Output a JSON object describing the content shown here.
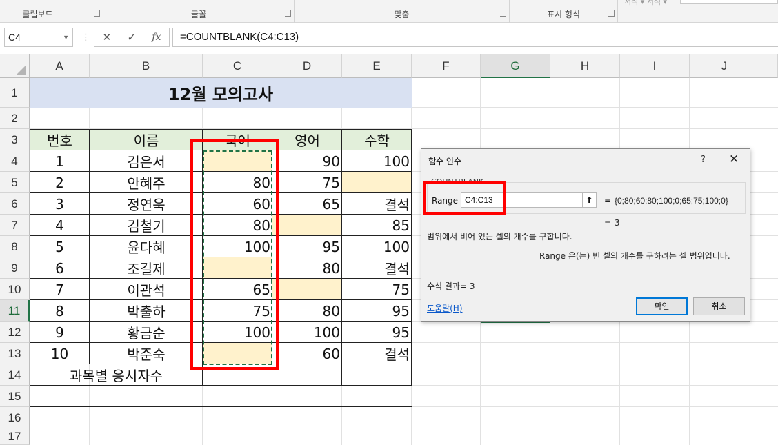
{
  "ribbon": {
    "groups": [
      {
        "label": "클립보드"
      },
      {
        "label": "글꼴"
      },
      {
        "label": "맞춤"
      },
      {
        "label": "표시 형식"
      }
    ],
    "truncated_label": "서식 ▾  서식 ▾"
  },
  "formula_bar": {
    "name_box": "C4",
    "cancel_symbol": "✕",
    "enter_symbol": "✓",
    "fx_symbol": "fx",
    "formula": "=COUNTBLANK(C4:C13)"
  },
  "sheet": {
    "columns": [
      "A",
      "B",
      "C",
      "D",
      "E",
      "F",
      "G",
      "H",
      "I",
      "J"
    ],
    "active_column": "G",
    "rows": [
      "1",
      "2",
      "3",
      "4",
      "5",
      "6",
      "7",
      "8",
      "9",
      "10",
      "11",
      "12",
      "13",
      "14",
      "15",
      "16",
      "17"
    ],
    "active_row": "11",
    "title": "12월 모의고사",
    "headers": [
      "번호",
      "이름",
      "국어",
      "영어",
      "수학"
    ],
    "records": [
      {
        "no": "1",
        "name": "김은서",
        "kor": "",
        "eng": "90",
        "math": "100"
      },
      {
        "no": "2",
        "name": "안혜주",
        "kor": "80",
        "eng": "75",
        "math": ""
      },
      {
        "no": "3",
        "name": "정연욱",
        "kor": "60",
        "eng": "65",
        "math": "결석"
      },
      {
        "no": "4",
        "name": "김철기",
        "kor": "80",
        "eng": "",
        "math": "85"
      },
      {
        "no": "5",
        "name": "윤다혜",
        "kor": "100",
        "eng": "95",
        "math": "100"
      },
      {
        "no": "6",
        "name": "조길제",
        "kor": "",
        "eng": "80",
        "math": "결석"
      },
      {
        "no": "7",
        "name": "이관석",
        "kor": "65",
        "eng": "",
        "math": "75"
      },
      {
        "no": "8",
        "name": "박출하",
        "kor": "75",
        "eng": "80",
        "math": "95"
      },
      {
        "no": "9",
        "name": "황금순",
        "kor": "100",
        "eng": "100",
        "math": "95"
      },
      {
        "no": "10",
        "name": "박준숙",
        "kor": "",
        "eng": "60",
        "math": "결석"
      }
    ],
    "summary_label": "과목별 응시자수",
    "colors": {
      "title_fill": "#d9e1f2",
      "header_fill": "#e2efda",
      "blank_fill": "#fff2cc",
      "highlight": "#ff0000",
      "excel_green": "#217346"
    }
  },
  "dialog": {
    "title": "함수 인수",
    "help_icon": "?",
    "close_icon": "✕",
    "function_name": "COUNTBLANK",
    "arg_label": "Range",
    "arg_value": "C4:C13",
    "collapse_icon": "⬆",
    "eq": "=",
    "arg_result": "{0;80;60;80;100;0;65;75;100;0}",
    "func_result_inline": "3",
    "description": "범위에서 비어 있는 셀의 개수를 구합니다.",
    "arg_description": "Range  은(는) 빈 셀의 개수를 구하려는 셀 범위입니다.",
    "formula_result": "수식 결과=  3",
    "help_link": "도움말(H)",
    "ok_label": "확인",
    "cancel_label": "취소"
  }
}
